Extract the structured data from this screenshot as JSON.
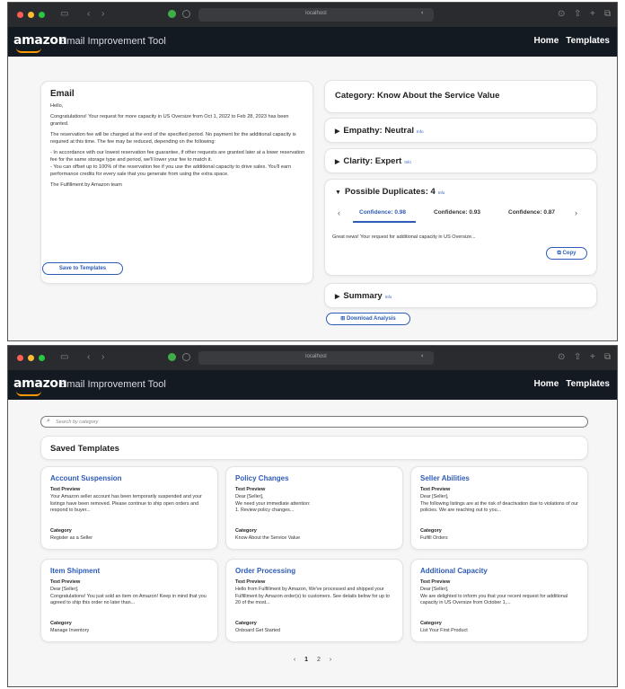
{
  "browser": {
    "url": "localhost"
  },
  "app": {
    "logo": "amazon",
    "title": "Email Improvement Tool",
    "nav": [
      "Home",
      "Templates"
    ]
  },
  "email_view": {
    "heading": "Email",
    "paragraphs": [
      "Hello,",
      "Congratulations! Your request for more capacity in US Oversize from Oct 1, 2022 to Feb 28, 2023 has been granted.",
      "The reservation fee will be charged at the end of the specified period. No payment for the additional capacity is required at this time. The fee may be reduced, depending on the following:",
      "- In accordance with our lowest reservation fee guarantee, if other requests are granted later at a lower reservation fee for the same storage type and period, we'll lower your fee to match it.\n- You can offset up to 100% of the reservation fee if you use the additional capacity to drive sales. You'll earn performance credits for every sale that you generate from using the extra space.",
      "The Fulfillment by Amazon team"
    ],
    "save_button": "Save to Templates"
  },
  "analysis": {
    "category": "Category: Know About the Service Value",
    "empathy": "Empathy: Neutral",
    "clarity": "Clarity: Expert",
    "info_label": "Info",
    "duplicates": {
      "title": "Possible Duplicates: 4",
      "tabs": [
        "Confidence: 0.98",
        "Confidence: 0.93",
        "Confidence: 0.87"
      ],
      "active_tab": 0,
      "preview": "Great news! Your request for additional capacity in US Oversize...",
      "copy_button": "Copy"
    },
    "summary": "Summary",
    "download_button": "Download Analysis"
  },
  "templates_view": {
    "search_placeholder": "Search by category",
    "heading": "Saved Templates",
    "preview_label": "Text Preview",
    "category_label": "Category",
    "templates": [
      {
        "title": "Account Suspension",
        "preview": "Your Amazon seller account has been temporarily suspended and your listings have been removed. Please continue to ship open orders and respond to buyer...",
        "category": "Register as a Seller"
      },
      {
        "title": "Policy Changes",
        "preview": "Dear [Seller],\nWe need your immediate attention:\n1. Review policy changes...",
        "category": "Know About the Service Value"
      },
      {
        "title": "Seller Abilities",
        "preview": "Dear [Seller],\nThe following listings are at the risk of deactivation due to violations of our policies. We are reaching out to you...",
        "category": "Fulfill Orders"
      },
      {
        "title": "Item Shipment",
        "preview": "Dear [Seller],\nCongratulations! You just sold an item on Amazon! Keep in mind that you agreed to ship this order no later than...",
        "category": "Manage Inventory"
      },
      {
        "title": "Order Processing",
        "preview": "Hello from Fulfillment by Amazon, We've processed and shipped your Fulfillment by Amazon order(s) to customers. See details below for up to 20 of the most...",
        "category": "Onboard Get Started"
      },
      {
        "title": "Additional Capacity",
        "preview": "Dear [Seller],\nWe are delighted to inform you that your recent request for additional capacity in US Oversize from October 1,...",
        "category": "List Your First Product"
      }
    ],
    "pagination": {
      "pages": [
        "1",
        "2"
      ],
      "current": "1"
    }
  }
}
